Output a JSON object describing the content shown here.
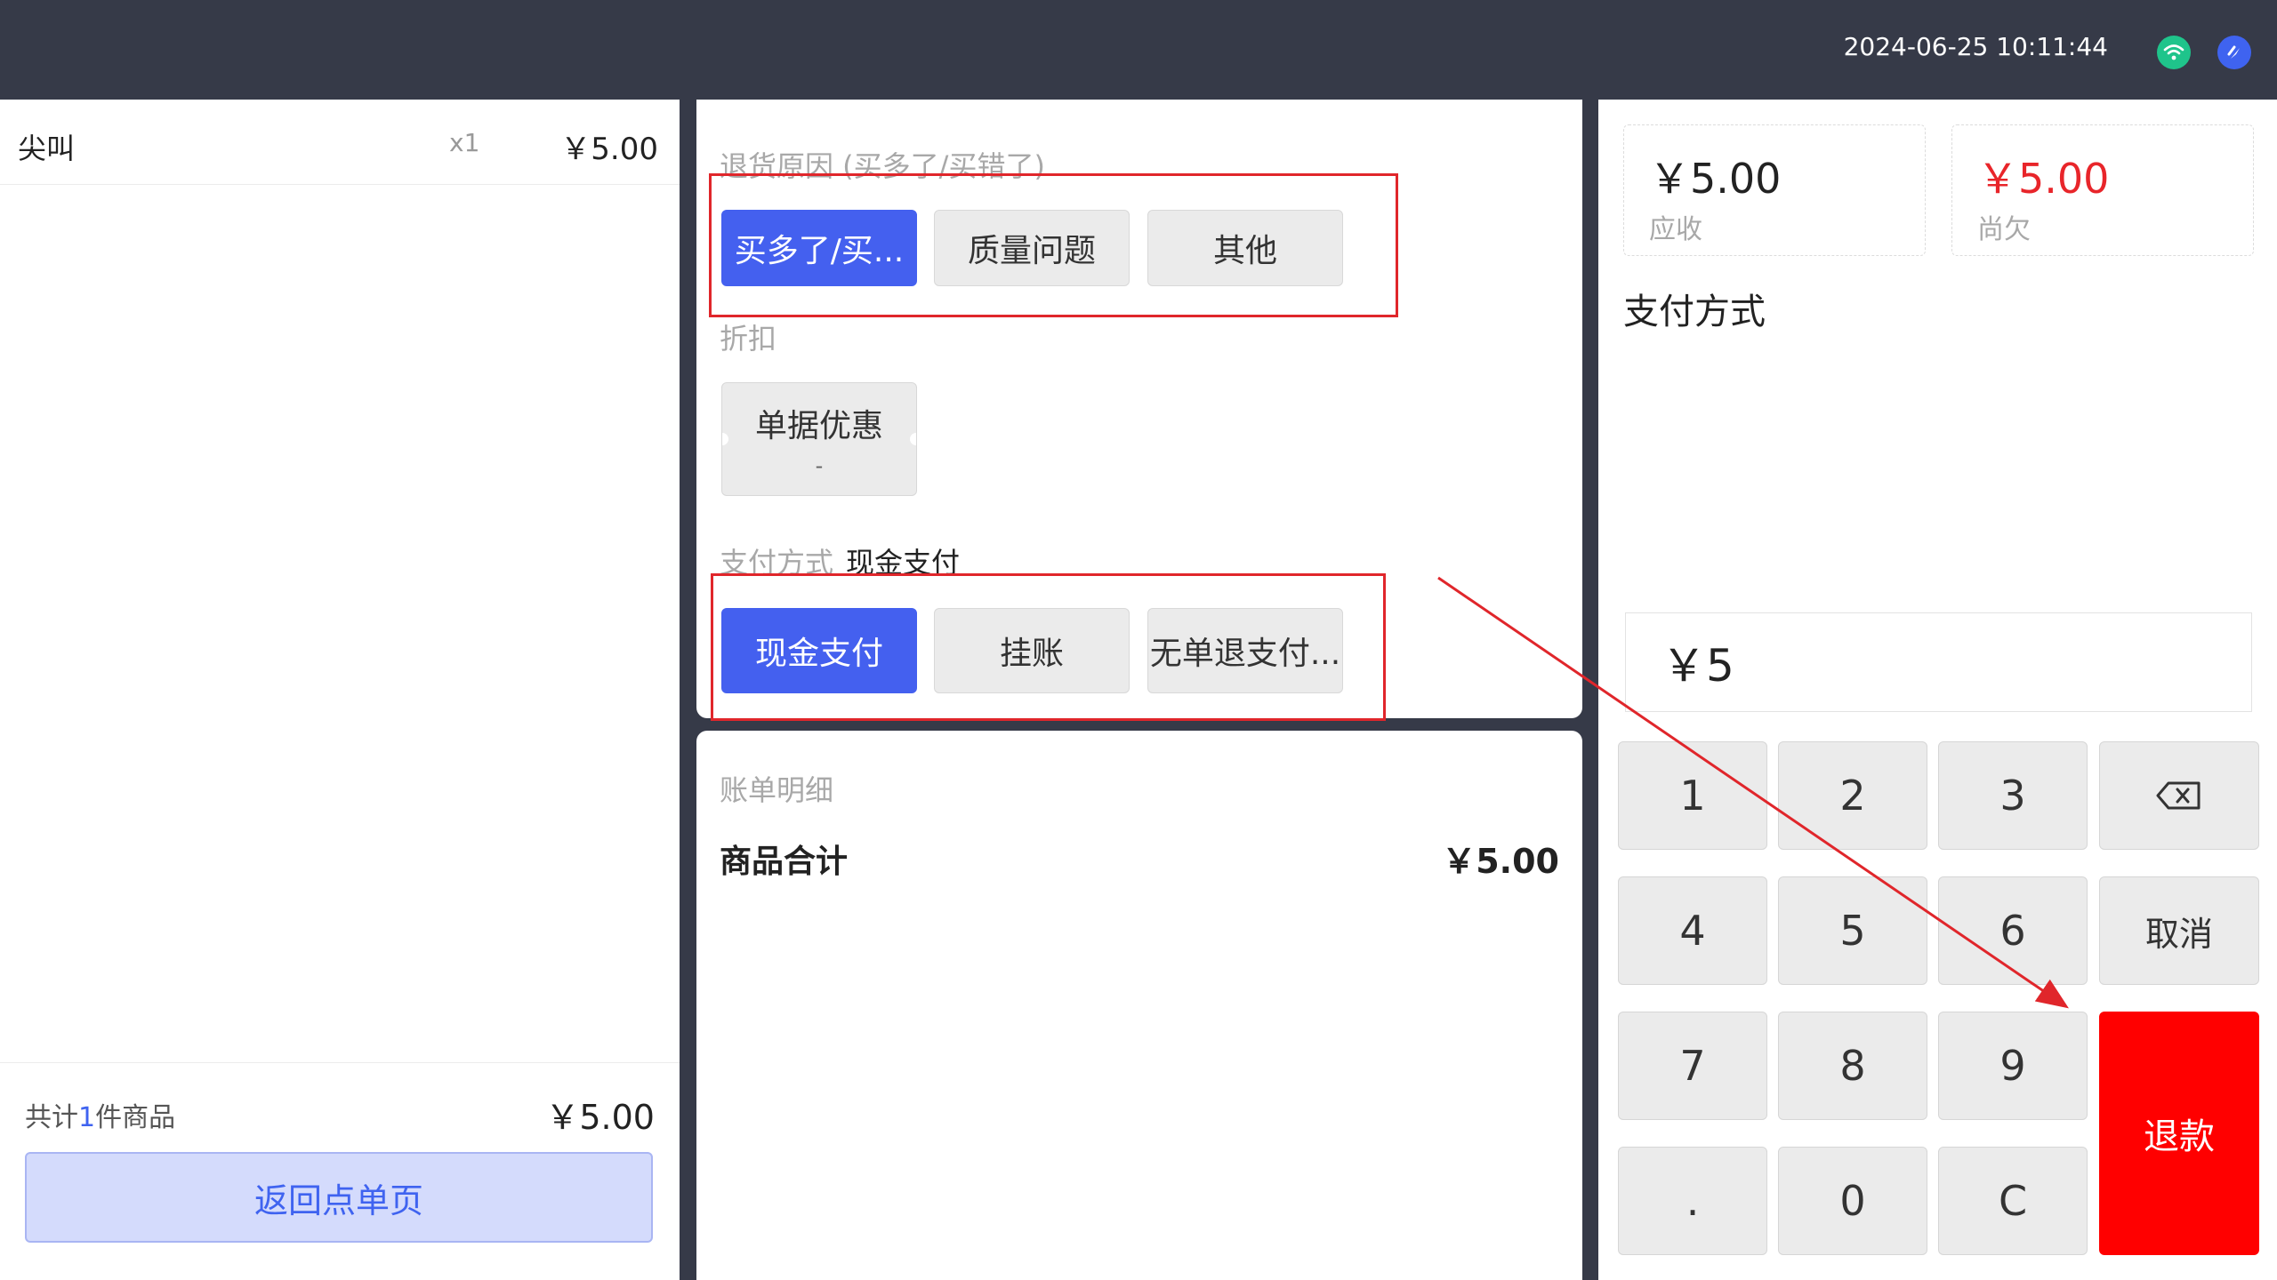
{
  "header": {
    "datetime": "2024-06-25 10:11:44",
    "icons": [
      "wifi-icon",
      "brand-logo-icon"
    ]
  },
  "cart": {
    "items": [
      {
        "name": "尖叫",
        "qty": "x1",
        "price": "￥5.00"
      }
    ],
    "total_prefix": "共计",
    "total_count": "1",
    "total_suffix": "件商品",
    "total_amount": "￥5.00",
    "back_label": "返回点单页"
  },
  "return_reason": {
    "label": "退货原因 (买多了/买错了)",
    "options": [
      "买多了/买...",
      "质量问题",
      "其他"
    ],
    "selected": 0
  },
  "discount": {
    "label": "折扣",
    "ticket_title": "单据优惠",
    "ticket_value": "-"
  },
  "payment": {
    "label": "支付方式",
    "current": "现金支付",
    "options": [
      "现金支付",
      "挂账",
      "无单退支付..."
    ],
    "selected": 0
  },
  "bill": {
    "label": "账单明细",
    "row_label": "商品合计",
    "row_amount": "￥5.00"
  },
  "summary": {
    "receivable_amount": "￥5.00",
    "receivable_label": "应收",
    "owed_amount": "￥5.00",
    "owed_label": "尚欠",
    "owed_color": "#e8252a"
  },
  "payment_methods_title": "支付方式",
  "amount_input": "￥5",
  "keypad": {
    "digits": [
      "1",
      "2",
      "3",
      "4",
      "5",
      "6",
      "7",
      "8",
      "9",
      ".",
      "0",
      "C"
    ],
    "backspace_icon": "backspace-icon",
    "cancel_label": "取消",
    "refund_label": "退款",
    "refund_color": "#ff0000"
  },
  "annotations": {
    "highlight_color": "#e0262b"
  }
}
